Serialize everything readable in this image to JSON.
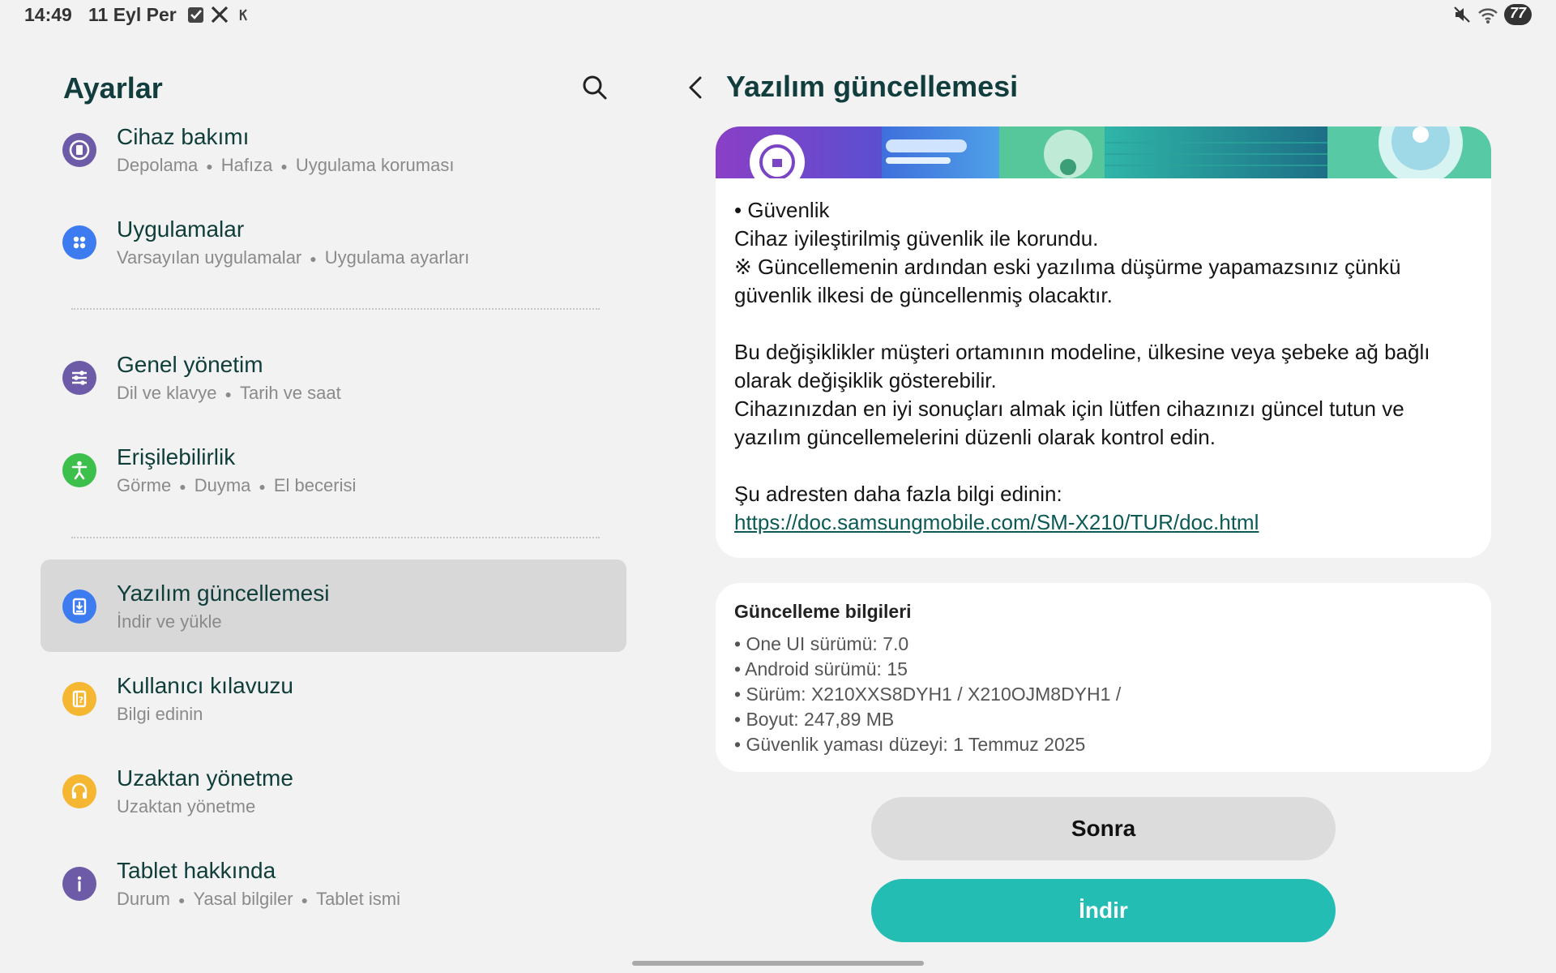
{
  "status_bar": {
    "time": "14:49",
    "date": "11 Eyl Per",
    "battery": "77",
    "left_icons": [
      "checkbox-icon",
      "x-logo-icon",
      "k-icon"
    ],
    "right_icons": [
      "mute-icon",
      "wifi-icon",
      "battery-icon"
    ]
  },
  "left": {
    "title": "Ayarlar",
    "items": [
      {
        "title": "Cihaz bakımı",
        "subs": [
          "Depolama",
          "Hafıza",
          "Uygulama koruması"
        ],
        "icon": "device-care-icon",
        "color": "#6e5ba8"
      },
      {
        "title": "Uygulamalar",
        "subs": [
          "Varsayılan uygulamalar",
          "Uygulama ayarları"
        ],
        "icon": "apps-icon",
        "color": "#3c7cf0"
      },
      {
        "title": "Genel yönetim",
        "subs": [
          "Dil ve klavye",
          "Tarih ve saat"
        ],
        "icon": "sliders-icon",
        "color": "#6e5ba8"
      },
      {
        "title": "Erişilebilirlik",
        "subs": [
          "Görme",
          "Duyma",
          "El becerisi"
        ],
        "icon": "accessibility-icon",
        "color": "#3cbf4b"
      },
      {
        "title": "Yazılım güncellemesi",
        "subs": [
          "İndir ve yükle"
        ],
        "icon": "software-update-icon",
        "color": "#3c7cf0"
      },
      {
        "title": "Kullanıcı kılavuzu",
        "subs": [
          "Bilgi edinin"
        ],
        "icon": "user-manual-icon",
        "color": "#f5b731"
      },
      {
        "title": "Uzaktan yönetme",
        "subs": [
          "Uzaktan yönetme"
        ],
        "icon": "headset-icon",
        "color": "#f5b731"
      },
      {
        "title": "Tablet hakkında",
        "subs": [
          "Durum",
          "Yasal bilgiler",
          "Tablet ismi"
        ],
        "icon": "info-icon",
        "color": "#6e5ba8"
      }
    ]
  },
  "right": {
    "title": "Yazılım güncellemesi",
    "security_heading": "• Güvenlik",
    "security_line1": "Cihaz iyileştirilmiş güvenlik ile korundu.",
    "security_line2": "※ Güncellemenin ardından eski yazılıma düşürme yapamazsınız çünkü",
    "security_line3": "güvenlik ilkesi de güncellenmiş olacaktır.",
    "note_line1": "Bu değişiklikler müşteri ortamının modeline, ülkesine veya şebeke ağ bağlı",
    "note_line2": "olarak değişiklik gösterebilir.",
    "note_line3": "Cihazınızdan en iyi sonuçları almak için lütfen cihazınızı güncel tutun ve",
    "note_line4": "yazılım güncellemelerini düzenli olarak kontrol edin.",
    "more_info": "Şu adresten daha fazla bilgi edinin:",
    "link": "https://doc.samsungmobile.com/SM-X210/TUR/doc.html",
    "info_title": "Güncelleme bilgileri",
    "info_items": [
      "• One UI sürümü: 7.0",
      "• Android sürümü: 15",
      "• Sürüm: X210XXS8DYH1 / X210OJM8DYH1 /",
      "• Boyut: 247,89 MB",
      "• Güvenlik yaması düzeyi: 1 Temmuz 2025"
    ],
    "btn_later": "Sonra",
    "btn_download": "İndir"
  },
  "colors": {
    "title": "#123d3d",
    "item_title": "#0e3d3a",
    "accent_button": "#23bdb3",
    "active_row": "#d8d8d8"
  }
}
